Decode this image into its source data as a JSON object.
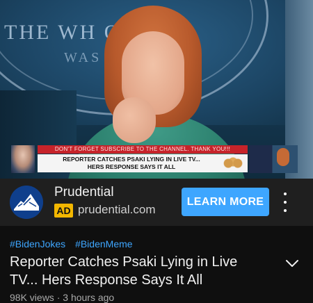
{
  "video": {
    "seal_text_line1": "THE WH    OUSE",
    "seal_text_line2": "WAS",
    "banner": {
      "top_line": "DON'T FORGET SUBSCRIBE TO THE CHANNEL. THANK YOU!!!",
      "line1": "REPORTER CATCHES PSAKI LYING IN LIVE TV...",
      "line2": "HERS RESPONSE SAYS IT ALL"
    }
  },
  "ad": {
    "advertiser": "Prudential",
    "badge": "AD",
    "domain": "prudential.com",
    "cta_label": "LEARN MORE",
    "logo_icon": "prudential-rock-logo-icon",
    "more_icon": "more-vertical-icon"
  },
  "info": {
    "hashtags": [
      "#BidenJokes",
      "#BidenMeme"
    ],
    "title": "Reporter Catches Psaki Lying in Live TV... Hers Response Says It All",
    "views": "98K views",
    "separator": "·",
    "time_ago": "3 hours ago",
    "expand_icon": "chevron-down-icon"
  },
  "colors": {
    "background": "#0f0f0f",
    "ad_bar": "#1f1f1f",
    "accent_blue": "#3ea6ff",
    "ad_badge": "#f3b700",
    "banner_red": "#c6232a"
  }
}
